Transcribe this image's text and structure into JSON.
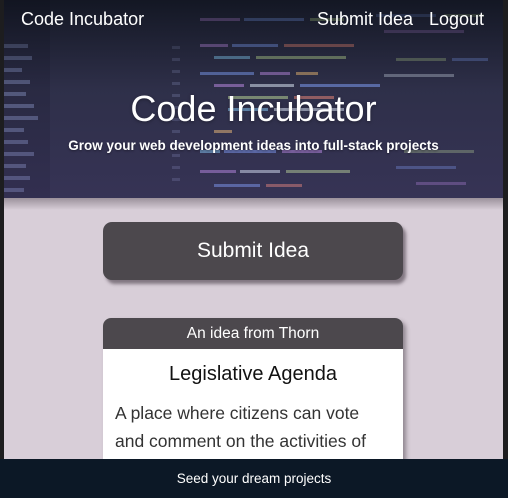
{
  "navbar": {
    "brand": "Code Incubator",
    "links": [
      "Submit Idea",
      "Logout"
    ]
  },
  "hero": {
    "title": "Code Incubator",
    "subtitle": "Grow your web development ideas into full-stack projects"
  },
  "main": {
    "submit_button_label": "Submit Idea",
    "idea_card": {
      "header": "An idea from Thorn",
      "title": "Legislative Agenda",
      "body": "A place where citizens can vote and comment on the activities of"
    }
  },
  "footer": {
    "text": "Seed your dream projects"
  },
  "colors": {
    "page_background": "#d8ced8",
    "button_background": "#4c484d",
    "footer_background": "#0c1826",
    "hero_tint": "#3c375f"
  }
}
